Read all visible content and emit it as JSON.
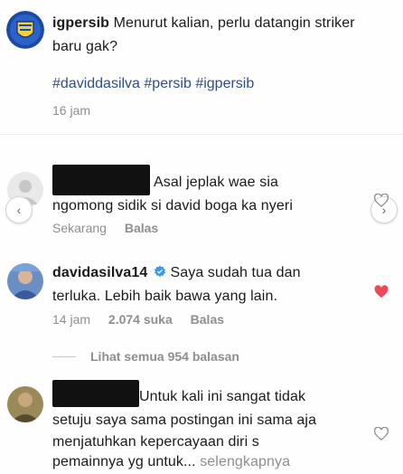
{
  "post": {
    "username": "igpersib",
    "caption": "Menurut kalian, perlu datangin striker baru gak?",
    "caption_line1": " Menurut kalian, perlu datangin striker",
    "caption_line2": "baru gak?",
    "hashtags": "#daviddasilva #persib #igpersib",
    "time": "16 jam"
  },
  "comments": [
    {
      "username_redacted": true,
      "text_line1": "Asal jeplak wae sia",
      "text_line2": "ngomong sidik si david boga ka nyeri",
      "time": "Sekarang",
      "reply_label": "Balas",
      "liked": false
    },
    {
      "username": "davidasilva14",
      "verified": true,
      "text_line1": " Saya sudah tua dan",
      "text_line2": "terluka. Lebih baik bawa yang lain.",
      "time": "14 jam",
      "likes": "2.074 suka",
      "reply_label": "Balas",
      "liked": true,
      "view_replies": "Lihat semua 954 balasan"
    },
    {
      "username_redacted": true,
      "text_line1": "Untuk kali ini sangat tidak",
      "text_line2": "setuju saya sama postingan ini sama aja",
      "text_line3": "menjatuhkan kepercayaan diri s",
      "text_line4_a": "pemainnya yg untuk...",
      "text_line4_b": "selengkapnya",
      "liked": false
    }
  ],
  "colors": {
    "hashtag": "#2b4f86",
    "meta_gray": "#8e8e8e",
    "like_red": "#ed4956",
    "verified_blue": "#3897f0"
  },
  "icons": [
    "persib-logo",
    "heart-icon",
    "heart-filled-icon",
    "verified-badge-icon",
    "chevron-left-icon",
    "chevron-right-icon"
  ]
}
